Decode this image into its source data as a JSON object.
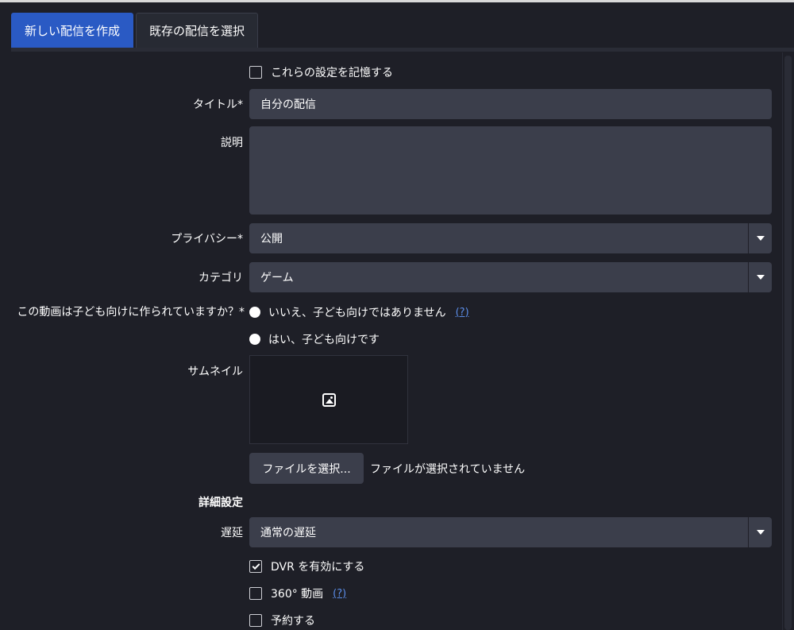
{
  "tabs": [
    {
      "label": "新しい配信を作成",
      "active": true
    },
    {
      "label": "既存の配信を選択",
      "active": false
    }
  ],
  "remember": {
    "label": "これらの設定を記憶する",
    "checked": false
  },
  "title": {
    "label": "タイトル*",
    "value": "自分の配信"
  },
  "description": {
    "label": "説明",
    "value": ""
  },
  "privacy": {
    "label": "プライバシー*",
    "value": "公開"
  },
  "category": {
    "label": "カテゴリ",
    "value": "ゲーム"
  },
  "kids": {
    "label": "この動画は子ども向けに作られていますか？*",
    "option_no": "いいえ、子ども向けではありません",
    "option_yes": "はい、子ども向けです",
    "help": "(?)"
  },
  "thumbnail": {
    "label": "サムネイル",
    "icon": "image-icon"
  },
  "file": {
    "button": "ファイルを選択...",
    "status": "ファイルが選択されていません"
  },
  "advanced": {
    "heading": "詳細設定"
  },
  "latency": {
    "label": "遅延",
    "value": "通常の遅延"
  },
  "dvr": {
    "label": "DVR を有効にする",
    "checked": true
  },
  "video360": {
    "label": "360° 動画",
    "checked": false,
    "help": "(?)"
  },
  "schedule": {
    "label": "予約する",
    "checked": false
  },
  "colors": {
    "accent": "#2a5ac4",
    "background": "#1e1f27",
    "field": "#3b3e4b",
    "link": "#5b8de8"
  }
}
